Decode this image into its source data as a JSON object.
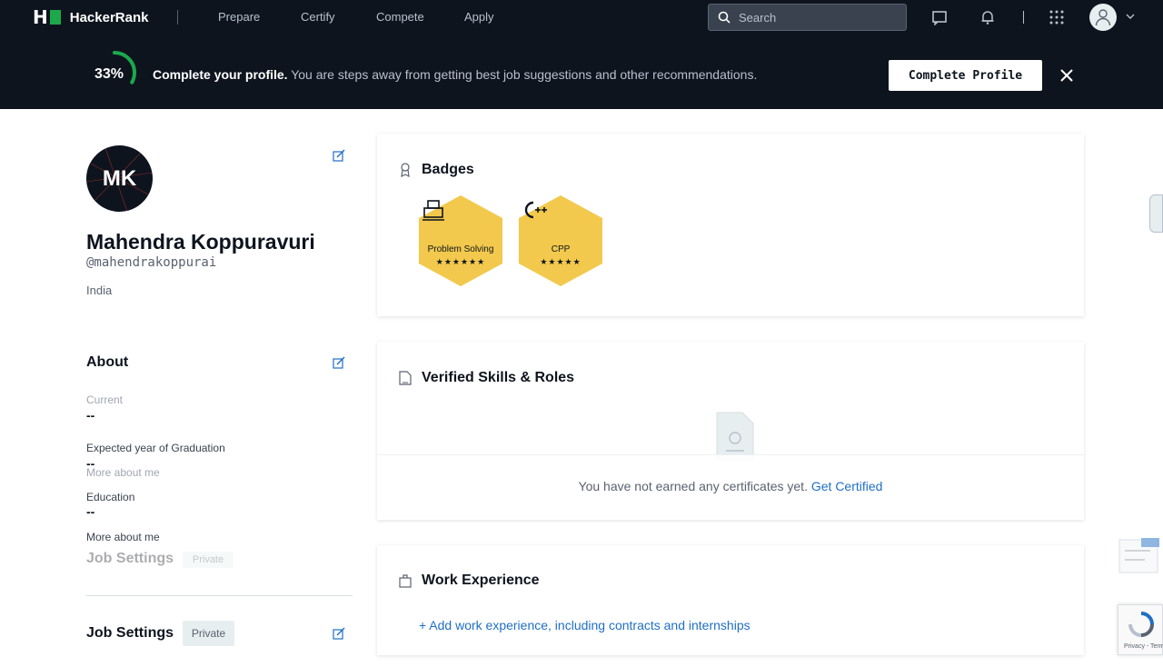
{
  "topnav": {
    "logo_text": "HackerRank",
    "links": [
      "Prepare",
      "Certify",
      "Compete",
      "Apply"
    ],
    "search_placeholder": "Search"
  },
  "banner": {
    "progress": "33%",
    "progress_value": 0.33,
    "headline": "Complete your profile.",
    "message": " You are steps away from getting best job suggestions and other recommendations.",
    "button_label": "Complete Profile"
  },
  "profile": {
    "initials": "MK",
    "name": "Mahendra Koppuravuri",
    "handle": "@mahendrakoppurai",
    "country": "India"
  },
  "about": {
    "title": "About",
    "current_label": "Current",
    "current_value": "--",
    "grad_label": "Expected year of Graduation",
    "grad_value": "--",
    "more_ghost": "More about me",
    "education_label": "Education",
    "education_value": "--",
    "more_label": "More about me"
  },
  "job_settings": {
    "title": "Job Settings",
    "badge": "Private"
  },
  "badges": {
    "title": "Badges",
    "items": [
      {
        "name": "Problem Solving",
        "stars": "★★★★★★",
        "icon": "problem-solving-icon"
      },
      {
        "name": "CPP",
        "stars": "★★★★★",
        "icon": "cpp-icon"
      }
    ],
    "color": "#f2c94c"
  },
  "skills": {
    "title": "Verified Skills & Roles",
    "empty_text": "You have not earned any certificates yet. ",
    "empty_link": "Get Certified"
  },
  "work": {
    "title": "Work Experience",
    "add_link": "+ Add work experience, including contracts and internships"
  },
  "colors": {
    "nav_bg": "#0e141e",
    "accent_green": "#1ba94c",
    "link_blue": "#1f6fc5"
  }
}
